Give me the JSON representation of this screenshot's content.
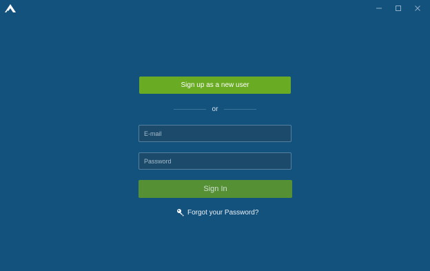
{
  "window": {
    "logo_icon": "nordvpn-mountain-logo",
    "controls": {
      "minimize_icon": "minimize-icon",
      "maximize_icon": "maximize-icon",
      "close_icon": "close-icon"
    }
  },
  "login": {
    "signup_label": "Sign up as a new user",
    "divider_text": "or",
    "email_placeholder": "E-mail",
    "password_placeholder": "Password",
    "signin_label": "Sign In",
    "forgot_label": "Forgot your Password?",
    "forgot_icon": "key-icon"
  },
  "colors": {
    "background": "#14527e",
    "signup_button": "#6aab24",
    "signin_button": "#559035",
    "input_background": "#1b4a6b"
  }
}
